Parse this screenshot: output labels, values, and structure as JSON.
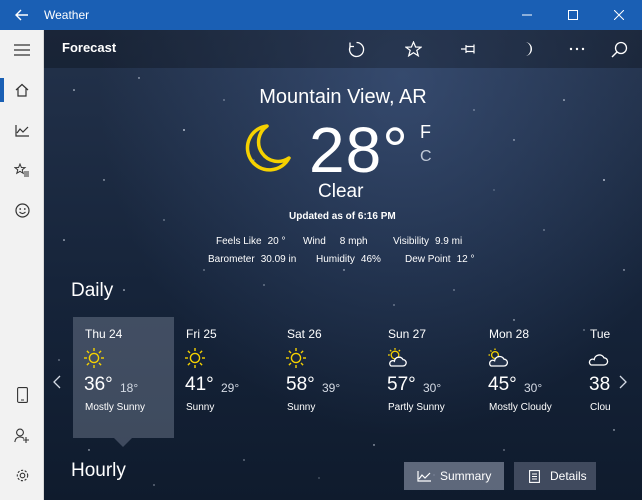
{
  "window": {
    "title": "Weather",
    "controls": [
      "minimize-icon",
      "maximize-icon",
      "close-icon"
    ]
  },
  "rail": {
    "items": [
      "hamburger-menu-icon",
      "home-icon",
      "historical-weather-icon",
      "favorites-icon",
      "smiley-icon",
      "phone-icon",
      "add-user-icon",
      "settings-icon"
    ],
    "selected": "home-icon",
    "accent": "#1a5fb4"
  },
  "commandbar": {
    "title": "Forecast",
    "actions": [
      "refresh-icon",
      "favorite-star-icon",
      "pin-icon",
      "night-mode-moon-icon",
      "more-icon",
      "search-icon"
    ]
  },
  "current": {
    "location": "Mountain View, AR",
    "temperature": "28°",
    "unit_f": "F",
    "unit_c": "C",
    "condition": "Clear",
    "updated": "Updated as of 6:16 PM",
    "details": [
      {
        "label": "Feels Like",
        "value": "20 °"
      },
      {
        "label": "Wind",
        "value": "8 mph"
      },
      {
        "label": "Visibility",
        "value": "9.9 mi"
      },
      {
        "label": "Barometer",
        "value": "30.09 in"
      },
      {
        "label": "Humidity",
        "value": "46%"
      },
      {
        "label": "Dew Point",
        "value": "12 °"
      }
    ],
    "icon": "crescent-moon-icon",
    "icon_color": "#f5d100"
  },
  "daily": {
    "heading": "Daily",
    "days": [
      {
        "name": "Thu 24",
        "high": "36°",
        "low": "18°",
        "condition": "Mostly Sunny",
        "icon": "mostly-sunny-icon",
        "selected": true
      },
      {
        "name": "Fri 25",
        "high": "41°",
        "low": "29°",
        "condition": "Sunny",
        "icon": "sunny-icon"
      },
      {
        "name": "Sat 26",
        "high": "58°",
        "low": "39°",
        "condition": "Sunny",
        "icon": "sunny-icon"
      },
      {
        "name": "Sun 27",
        "high": "57°",
        "low": "30°",
        "condition": "Partly Sunny",
        "icon": "partly-sunny-icon"
      },
      {
        "name": "Mon 28",
        "high": "45°",
        "low": "30°",
        "condition": "Mostly Cloudy",
        "icon": "mostly-cloudy-icon"
      },
      {
        "name": "Tue",
        "high": "38",
        "low": "",
        "condition": "Clou",
        "icon": "cloudy-icon"
      }
    ]
  },
  "hourly": {
    "heading": "Hourly",
    "summary_label": "Summary",
    "details_label": "Details",
    "active_view": "Summary"
  }
}
